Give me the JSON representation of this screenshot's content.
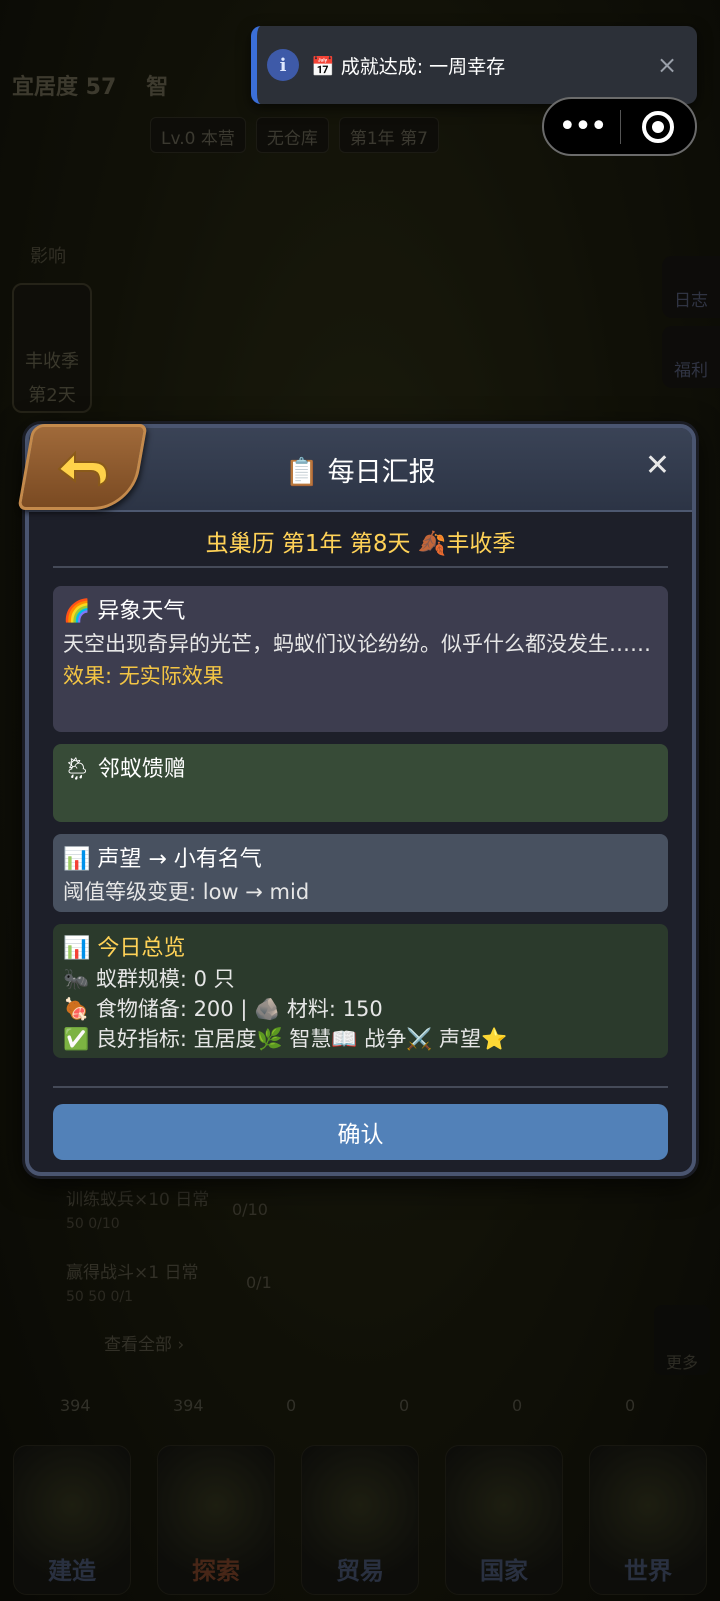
{
  "toast": {
    "icon": "info-icon",
    "text": "📅 成就达成: 一周幸存",
    "close": "×"
  },
  "capsule": {
    "more": "•••"
  },
  "background": {
    "habitability": "宜居度 57",
    "wisdom": "智",
    "tags": [
      "Lv.0 本营",
      "无仓库",
      "第1年 第7"
    ],
    "influence_label": "影响",
    "influence_card": [
      "丰收季",
      "第2天"
    ],
    "side": [
      "日志",
      "福利"
    ],
    "tasks": [
      {
        "title": "训练蚁兵×10 日常",
        "sub": "50  0/10",
        "count": "0/10"
      },
      {
        "title": "赢得战斗×1 日常",
        "sub": "50  50  0/1",
        "count": "0/1"
      }
    ],
    "view_all": "查看全部 ›",
    "more": "更多",
    "resources": [
      "394",
      "394",
      "0",
      "0",
      "0",
      "0"
    ],
    "nav": [
      "建造",
      "探索",
      "贸易",
      "国家",
      "世界"
    ]
  },
  "modal": {
    "title": "📋 每日汇报",
    "close": "✕",
    "date": "虫巢历 第1年 第8天 🍂丰收季",
    "weather": {
      "title": "🌈 异象天气",
      "body": "天空出现奇异的光芒，蚂蚁们议论纷纷。似乎什么都没发生……",
      "effect": "效果: 无实际效果"
    },
    "gift": {
      "title": "🌦 邻蚁馈赠"
    },
    "prestige": {
      "title": "📊 声望 → 小有名气",
      "body": "阈值等级变更: low → mid"
    },
    "summary": {
      "title": "📊 今日总览",
      "lines": [
        "🐜 蚁群规模: 0 只",
        "🍖 食物储备: 200 | 🪨 材料: 150",
        "✅ 良好指标: 宜居度🌿 智慧📖 战争⚔️ 声望⭐"
      ]
    },
    "confirm": "确认"
  },
  "colors": {
    "accent_blue": "#5281b8",
    "title_gold": "#ffd257",
    "effect_gold": "#f3c544",
    "toast_bar": "#3b6fd8"
  }
}
